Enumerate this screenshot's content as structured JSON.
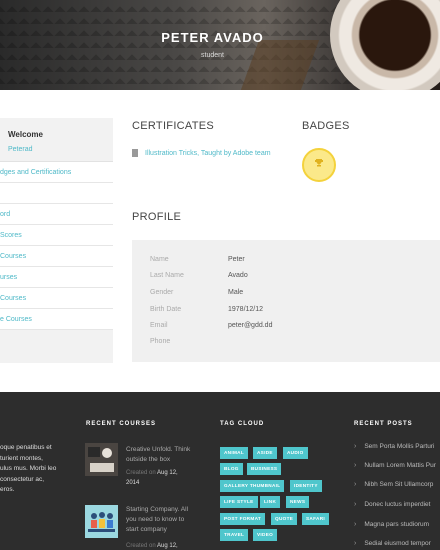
{
  "hero": {
    "name": "PETER AVADO",
    "role": "student"
  },
  "sidebar": {
    "welcome": "Welcome",
    "username": "Peterad",
    "items": [
      "dges and Certifications",
      "",
      "ord",
      "Scores",
      "Courses",
      "urses",
      "Courses",
      "e Courses"
    ]
  },
  "certificates": {
    "heading": "CERTIFICATES",
    "items": [
      "Illustration Tricks, Taught by Adobe team"
    ]
  },
  "badges": {
    "heading": "BADGES",
    "icon": "trophy-icon"
  },
  "profile": {
    "heading": "PROFILE",
    "rows": [
      {
        "label": "Name",
        "value": "Peter"
      },
      {
        "label": "Last Name",
        "value": "Avado"
      },
      {
        "label": "Gender",
        "value": "Male"
      },
      {
        "label": "Birth Date",
        "value": "1978/12/12"
      },
      {
        "label": "Email",
        "value": "peter@gdd.dd"
      },
      {
        "label": "Phone",
        "value": ""
      }
    ]
  },
  "footer": {
    "about_lines": [
      "oque penatibus et",
      "turient montes,",
      "ulus mus. Morbi leo",
      "consectetur ac,",
      "eros."
    ],
    "recent_courses": {
      "heading": "RECENT COURSES",
      "items": [
        {
          "title_lines": [
            "Creative Unfold. Think",
            "outside the box"
          ],
          "created": "Created on",
          "date": "Aug 12,",
          "year": "2014"
        },
        {
          "title_lines": [
            "Starting Company. All",
            "you need to know to",
            "start company"
          ],
          "created": "Created on",
          "date": "Aug 12,",
          "year": ""
        }
      ]
    },
    "tag_cloud": {
      "heading": "TAG CLOUD",
      "tags": [
        "ANIMAL",
        "ASIDE",
        "AUDIO",
        "BLOG",
        "BUSINESS",
        "GALLERY THUMBNAIL",
        "IDENTITY",
        "LIFE STYLE",
        "LINK",
        "NEWS",
        "POST FORMAT",
        "QUOTE",
        "SAFARI",
        "TRAVEL",
        "VIDEO"
      ]
    },
    "recent_posts": {
      "heading": "RECENT POSTS",
      "items": [
        "Sem Porta Mollis Parturi",
        "Nullam Lorem Mattis Pur",
        "Nibh Sem Sit Ullamcorp",
        "Donec luctus imperdiet",
        "Magna pars studiorum",
        "Sedial eiusmod tempor"
      ]
    }
  },
  "colors": {
    "accent": "#4fb9c8",
    "tag": "#4fc6cc",
    "badge": "#fbe98a",
    "footer_bg": "#2d2d2d"
  }
}
